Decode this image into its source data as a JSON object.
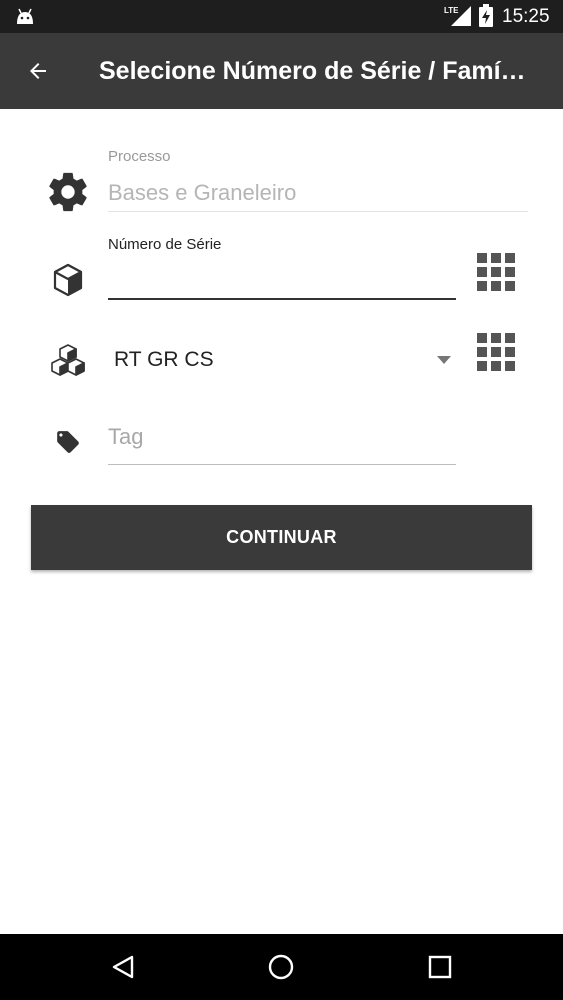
{
  "status_bar": {
    "network": "LTE",
    "time": "15:25",
    "icons": [
      "android-icon",
      "lte-signal-icon",
      "battery-charging-icon"
    ]
  },
  "app_bar": {
    "title": "Selecione Número de Série / Famí…",
    "back_icon": "arrow-back-icon"
  },
  "form": {
    "processo": {
      "label": "Processo",
      "value": "Bases e Graneleiro",
      "icon": "gear-icon"
    },
    "numero_serie": {
      "label": "Número de Série",
      "value": "",
      "icon": "cube-icon",
      "scan_icon": "grid-scan-icon"
    },
    "familia": {
      "selected": "RT GR CS",
      "icon": "cubes-icon",
      "dropdown_icon": "dropdown-arrow-icon",
      "scan_icon": "grid-scan-icon"
    },
    "tag": {
      "placeholder": "Tag",
      "value": "",
      "icon": "tag-icon"
    }
  },
  "actions": {
    "continue_label": "CONTINUAR"
  },
  "nav_bar": {
    "icons": [
      "back-triangle-icon",
      "home-circle-icon",
      "recents-square-icon"
    ]
  },
  "colors": {
    "app_bar": "#3a3a3a",
    "status_bar": "#1e1e1e",
    "button": "#3a3a3a",
    "icon": "#333333",
    "muted_text": "#999999"
  }
}
